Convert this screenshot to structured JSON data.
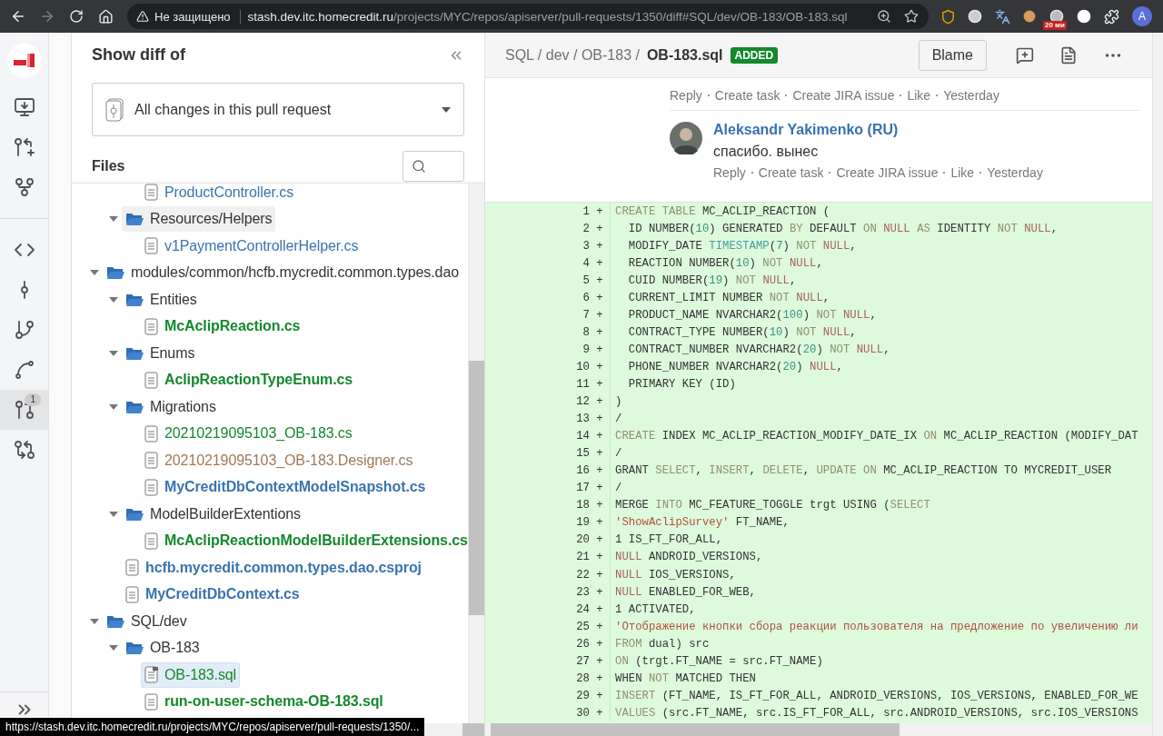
{
  "browser": {
    "security_label": "Не защищено",
    "url": {
      "host": "stash.dev.itc.homecredit.ru",
      "path": "/projects/MYC/repos/apiserver/pull-requests/1350/diff#SQL/dev/OB-183/OB-183.sql"
    },
    "extension_badge": "20 ми",
    "profile_initial": "A"
  },
  "rail": {
    "items": [
      {
        "selected": false
      },
      {
        "selected": false
      },
      {
        "selected": false
      },
      {
        "selected": false
      },
      {
        "selected": false
      },
      {
        "selected": false
      },
      {
        "selected": false
      },
      {
        "selected": true,
        "badge": "1"
      },
      {
        "selected": false
      }
    ]
  },
  "sidebar": {
    "title": "Show diff of",
    "scope": "All changes in this pull request",
    "files_label": "Files",
    "tree": [
      {
        "children": [
          {
            "children": [
              {
                "kind": "file",
                "label": "ProductController.cs",
                "color": "#3b73af",
                "viewed": true,
                "selected": false,
                "hovered": false,
                "has_comments": false
              }
            ]
          },
          {
            "kind": "folder",
            "label": "Resources/Helpers",
            "expanded": true,
            "selected": false,
            "hovered": true,
            "children": [
              {
                "kind": "file",
                "label": "v1PaymentControllerHelper.cs",
                "color": "#3b73af",
                "viewed": true,
                "selected": false,
                "hovered": false,
                "has_comments": false
              }
            ]
          }
        ]
      },
      {
        "kind": "folder",
        "label": "modules/common/hcfb.mycredit.common.types.dao",
        "expanded": true,
        "selected": false,
        "hovered": false,
        "children": [
          {
            "kind": "folder",
            "label": "Entities",
            "expanded": true,
            "selected": false,
            "hovered": false,
            "children": [
              {
                "kind": "file",
                "label": "McAclipReaction.cs",
                "color": "#14892c",
                "viewed": false,
                "selected": false,
                "hovered": false,
                "has_comments": false
              }
            ]
          },
          {
            "kind": "folder",
            "label": "Enums",
            "expanded": true,
            "selected": false,
            "hovered": false,
            "children": [
              {
                "kind": "file",
                "label": "AclipReactionTypeEnum.cs",
                "color": "#14892c",
                "viewed": false,
                "selected": false,
                "hovered": false,
                "has_comments": false
              }
            ]
          },
          {
            "kind": "folder",
            "label": "Migrations",
            "expanded": true,
            "selected": false,
            "hovered": false,
            "children": [
              {
                "kind": "file",
                "label": "20210219095103_OB-183.cs",
                "color": "#14892c",
                "viewed": true,
                "selected": false,
                "hovered": false,
                "has_comments": false
              },
              {
                "kind": "file",
                "label": "20210219095103_OB-183.Designer.cs",
                "color": "#a0785a",
                "viewed": true,
                "selected": false,
                "hovered": false,
                "has_comments": false
              },
              {
                "kind": "file",
                "label": "MyCreditDbContextModelSnapshot.cs",
                "color": "#3b73af",
                "viewed": false,
                "selected": false,
                "hovered": false,
                "has_comments": false
              }
            ]
          },
          {
            "kind": "folder",
            "label": "ModelBuilderExtentions",
            "expanded": true,
            "selected": false,
            "hovered": false,
            "children": [
              {
                "kind": "file",
                "label": "McAclipReactionModelBuilderExtensions.cs",
                "color": "#14892c",
                "viewed": false,
                "selected": false,
                "hovered": false,
                "has_comments": false
              }
            ]
          },
          {
            "kind": "file",
            "label": "hcfb.mycredit.common.types.dao.csproj",
            "color": "#3b73af",
            "viewed": false,
            "selected": false,
            "hovered": false,
            "has_comments": false
          },
          {
            "kind": "file",
            "label": "MyCreditDbContext.cs",
            "color": "#3b73af",
            "viewed": false,
            "selected": false,
            "hovered": false,
            "has_comments": false
          }
        ]
      },
      {
        "kind": "folder",
        "label": "SQL/dev",
        "expanded": true,
        "selected": false,
        "hovered": false,
        "children": [
          {
            "kind": "folder",
            "label": "OB-183",
            "expanded": true,
            "selected": false,
            "hovered": false,
            "children": [
              {
                "kind": "file",
                "label": "OB-183.sql",
                "color": "#14892c",
                "viewed": true,
                "selected": true,
                "hovered": false,
                "has_comments": true
              },
              {
                "kind": "file",
                "label": "run-on-user-schema-OB-183.sql",
                "color": "#14892c",
                "viewed": false,
                "selected": false,
                "hovered": false,
                "has_comments": false
              }
            ]
          }
        ]
      }
    ]
  },
  "diff": {
    "path": "SQL / dev / OB-183 /",
    "file_name": "OB-183.sql",
    "badge": "ADDED",
    "blame_button": "Blame",
    "previous_comment_actions": [
      "Reply",
      "Create task",
      "Create JIRA issue",
      "Like",
      "Yesterday"
    ],
    "comment": {
      "author": "Aleksandr Yakimenko (RU)",
      "text": "спасибо. вынес",
      "actions": [
        "Reply",
        "Create task",
        "Create JIRA issue",
        "Like",
        "Yesterday"
      ]
    },
    "lines": [
      {
        "num": "1",
        "sign": "+",
        "tokens": [
          {
            "text": "CREATE TABLE ",
            "kind": "keyword"
          },
          {
            "text": "MC_ACLIP_REACTION (",
            "kind": "plain"
          }
        ]
      },
      {
        "num": "2",
        "sign": "+",
        "tokens": [
          {
            "text": "  ID NUMBER(",
            "kind": "plain"
          },
          {
            "text": "10",
            "kind": "number"
          },
          {
            "text": ") GENERATED ",
            "kind": "plain"
          },
          {
            "text": "BY ",
            "kind": "keyword"
          },
          {
            "text": "DEFAULT ",
            "kind": "plain"
          },
          {
            "text": "ON ",
            "kind": "keyword"
          },
          {
            "text": "NULL ",
            "kind": "null"
          },
          {
            "text": "AS ",
            "kind": "keyword"
          },
          {
            "text": "IDENTITY ",
            "kind": "plain"
          },
          {
            "text": "NOT ",
            "kind": "keyword"
          },
          {
            "text": "NULL",
            "kind": "null"
          },
          {
            "text": ",",
            "kind": "plain"
          }
        ]
      },
      {
        "num": "3",
        "sign": "+",
        "tokens": [
          {
            "text": "  MODIFY_DATE ",
            "kind": "plain"
          },
          {
            "text": "TIMESTAMP",
            "kind": "type"
          },
          {
            "text": "(",
            "kind": "plain"
          },
          {
            "text": "7",
            "kind": "number"
          },
          {
            "text": ") ",
            "kind": "plain"
          },
          {
            "text": "NOT ",
            "kind": "keyword"
          },
          {
            "text": "NULL",
            "kind": "null"
          },
          {
            "text": ",",
            "kind": "plain"
          }
        ]
      },
      {
        "num": "4",
        "sign": "+",
        "tokens": [
          {
            "text": "  REACTION NUMBER(",
            "kind": "plain"
          },
          {
            "text": "10",
            "kind": "number"
          },
          {
            "text": ") ",
            "kind": "plain"
          },
          {
            "text": "NOT ",
            "kind": "keyword"
          },
          {
            "text": "NULL",
            "kind": "null"
          },
          {
            "text": ",",
            "kind": "plain"
          }
        ]
      },
      {
        "num": "5",
        "sign": "+",
        "tokens": [
          {
            "text": "  CUID NUMBER(",
            "kind": "plain"
          },
          {
            "text": "19",
            "kind": "number"
          },
          {
            "text": ") ",
            "kind": "plain"
          },
          {
            "text": "NOT ",
            "kind": "keyword"
          },
          {
            "text": "NULL",
            "kind": "null"
          },
          {
            "text": ",",
            "kind": "plain"
          }
        ]
      },
      {
        "num": "6",
        "sign": "+",
        "tokens": [
          {
            "text": "  CURRENT_LIMIT NUMBER ",
            "kind": "plain"
          },
          {
            "text": "NOT ",
            "kind": "keyword"
          },
          {
            "text": "NULL",
            "kind": "null"
          },
          {
            "text": ",",
            "kind": "plain"
          }
        ]
      },
      {
        "num": "7",
        "sign": "+",
        "tokens": [
          {
            "text": "  PRODUCT_NAME NVARCHAR2(",
            "kind": "plain"
          },
          {
            "text": "100",
            "kind": "number"
          },
          {
            "text": ") ",
            "kind": "plain"
          },
          {
            "text": "NOT ",
            "kind": "keyword"
          },
          {
            "text": "NULL",
            "kind": "null"
          },
          {
            "text": ",",
            "kind": "plain"
          }
        ]
      },
      {
        "num": "8",
        "sign": "+",
        "tokens": [
          {
            "text": "  CONTRACT_TYPE NUMBER(",
            "kind": "plain"
          },
          {
            "text": "10",
            "kind": "number"
          },
          {
            "text": ") ",
            "kind": "plain"
          },
          {
            "text": "NOT ",
            "kind": "keyword"
          },
          {
            "text": "NULL",
            "kind": "null"
          },
          {
            "text": ",",
            "kind": "plain"
          }
        ]
      },
      {
        "num": "9",
        "sign": "+",
        "tokens": [
          {
            "text": "  CONTRACT_NUMBER NVARCHAR2(",
            "kind": "plain"
          },
          {
            "text": "20",
            "kind": "number"
          },
          {
            "text": ") ",
            "kind": "plain"
          },
          {
            "text": "NOT ",
            "kind": "keyword"
          },
          {
            "text": "NULL",
            "kind": "null"
          },
          {
            "text": ",",
            "kind": "plain"
          }
        ]
      },
      {
        "num": "10",
        "sign": "+",
        "tokens": [
          {
            "text": "  PHONE_NUMBER NVARCHAR2(",
            "kind": "plain"
          },
          {
            "text": "20",
            "kind": "number"
          },
          {
            "text": ") ",
            "kind": "plain"
          },
          {
            "text": "NULL",
            "kind": "null"
          },
          {
            "text": ",",
            "kind": "plain"
          }
        ]
      },
      {
        "num": "11",
        "sign": "+",
        "tokens": [
          {
            "text": "  PRIMARY KEY (ID)",
            "kind": "plain"
          }
        ]
      },
      {
        "num": "12",
        "sign": "+",
        "tokens": [
          {
            "text": ")",
            "kind": "plain"
          }
        ]
      },
      {
        "num": "13",
        "sign": "+",
        "tokens": [
          {
            "text": "/",
            "kind": "plain"
          }
        ]
      },
      {
        "num": "14",
        "sign": "+",
        "tokens": [
          {
            "text": "CREATE ",
            "kind": "keyword"
          },
          {
            "text": "INDEX MC_ACLIP_REACTION_MODIFY_DATE_IX ",
            "kind": "plain"
          },
          {
            "text": "ON ",
            "kind": "keyword"
          },
          {
            "text": "MC_ACLIP_REACTION (MODIFY_DAT",
            "kind": "plain"
          }
        ]
      },
      {
        "num": "15",
        "sign": "+",
        "tokens": [
          {
            "text": "/",
            "kind": "plain"
          }
        ]
      },
      {
        "num": "16",
        "sign": "+",
        "tokens": [
          {
            "text": "GRANT ",
            "kind": "plain"
          },
          {
            "text": "SELECT",
            "kind": "keyword"
          },
          {
            "text": ", ",
            "kind": "plain"
          },
          {
            "text": "INSERT",
            "kind": "keyword"
          },
          {
            "text": ", ",
            "kind": "plain"
          },
          {
            "text": "DELETE",
            "kind": "keyword"
          },
          {
            "text": ", ",
            "kind": "plain"
          },
          {
            "text": "UPDATE ON ",
            "kind": "keyword"
          },
          {
            "text": "MC_ACLIP_REACTION TO MYCREDIT_USER",
            "kind": "plain"
          }
        ]
      },
      {
        "num": "17",
        "sign": "+",
        "tokens": [
          {
            "text": "/",
            "kind": "plain"
          }
        ]
      },
      {
        "num": "18",
        "sign": "+",
        "tokens": [
          {
            "text": "MERGE ",
            "kind": "plain"
          },
          {
            "text": "INTO ",
            "kind": "keyword"
          },
          {
            "text": "MC_FEATURE_TOGGLE trgt USING (",
            "kind": "plain"
          },
          {
            "text": "SELECT",
            "kind": "keyword"
          }
        ]
      },
      {
        "num": "19",
        "sign": "+",
        "tokens": [
          {
            "text": "'ShowAclipSurvey'",
            "kind": "string"
          },
          {
            "text": " FT_NAME,",
            "kind": "plain"
          }
        ]
      },
      {
        "num": "20",
        "sign": "+",
        "tokens": [
          {
            "text": "1 IS_FT_FOR_ALL,",
            "kind": "plain"
          }
        ]
      },
      {
        "num": "21",
        "sign": "+",
        "tokens": [
          {
            "text": "NULL",
            "kind": "null"
          },
          {
            "text": " ANDROID_VERSIONS,",
            "kind": "plain"
          }
        ]
      },
      {
        "num": "22",
        "sign": "+",
        "tokens": [
          {
            "text": "NULL",
            "kind": "null"
          },
          {
            "text": " IOS_VERSIONS,",
            "kind": "plain"
          }
        ]
      },
      {
        "num": "23",
        "sign": "+",
        "tokens": [
          {
            "text": "NULL",
            "kind": "null"
          },
          {
            "text": " ENABLED_FOR_WEB,",
            "kind": "plain"
          }
        ]
      },
      {
        "num": "24",
        "sign": "+",
        "tokens": [
          {
            "text": "1 ACTIVATED,",
            "kind": "plain"
          }
        ]
      },
      {
        "num": "25",
        "sign": "+",
        "tokens": [
          {
            "text": "'Отображение кнопки сбора реакции пользователя на предложение по увеличению ли",
            "kind": "string"
          }
        ]
      },
      {
        "num": "26",
        "sign": "+",
        "tokens": [
          {
            "text": "FROM ",
            "kind": "keyword"
          },
          {
            "text": "dual) src",
            "kind": "plain"
          }
        ]
      },
      {
        "num": "27",
        "sign": "+",
        "tokens": [
          {
            "text": "ON ",
            "kind": "keyword"
          },
          {
            "text": "(trgt.FT_NAME = src.FT_NAME)",
            "kind": "plain"
          }
        ]
      },
      {
        "num": "28",
        "sign": "+",
        "tokens": [
          {
            "text": "WHEN ",
            "kind": "plain"
          },
          {
            "text": "NOT ",
            "kind": "keyword"
          },
          {
            "text": "MATCHED THEN",
            "kind": "plain"
          }
        ]
      },
      {
        "num": "29",
        "sign": "+",
        "tokens": [
          {
            "text": "INSERT ",
            "kind": "keyword"
          },
          {
            "text": "(FT_NAME, IS_FT_FOR_ALL, ANDROID_VERSIONS, IOS_VERSIONS, ENABLED_FOR_WE",
            "kind": "plain"
          }
        ]
      },
      {
        "num": "30",
        "sign": "+",
        "tokens": [
          {
            "text": "VALUES ",
            "kind": "keyword"
          },
          {
            "text": "(src.FT_NAME, src.IS_FT_FOR_ALL, src.ANDROID_VERSIONS, src.IOS_VERSIONS",
            "kind": "plain"
          }
        ]
      }
    ]
  },
  "status_bar": {
    "link_preview": "https://stash.dev.itc.homecredit.ru/projects/MYC/repos/apiserver/pull-requests/1350/..."
  }
}
